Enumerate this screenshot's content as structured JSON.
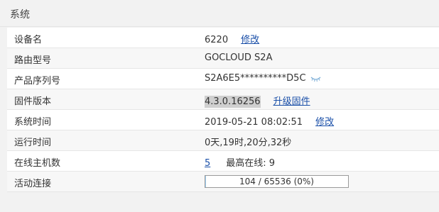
{
  "panel": {
    "title": "系统"
  },
  "rows": {
    "device_name": {
      "label": "设备名",
      "value": "6220",
      "action": "修改"
    },
    "router_model": {
      "label": "路由型号",
      "value": "GOCLOUD S2A"
    },
    "serial": {
      "label": "产品序列号",
      "value": "S2A6E5**********D5C",
      "icon": "eye-closed-icon"
    },
    "firmware": {
      "label": "固件版本",
      "value": "4.3.0.16256",
      "action": "升级固件"
    },
    "system_time": {
      "label": "系统时间",
      "value": "2019-05-21 08:02:51",
      "action": "修改"
    },
    "uptime": {
      "label": "运行时间",
      "value": "0天,19时,20分,32秒"
    },
    "online_hosts": {
      "label": "在线主机数",
      "value": "5",
      "max_label": "最高在线: 9"
    },
    "active_connections": {
      "label": "活动连接",
      "value": "104 / 65536 (0%)",
      "progress_fraction": 0.0016
    }
  },
  "colors": {
    "link": "#1a4fa8",
    "progress_fill": "#9ccbf0",
    "panel_bg": "#f2f2f2"
  }
}
